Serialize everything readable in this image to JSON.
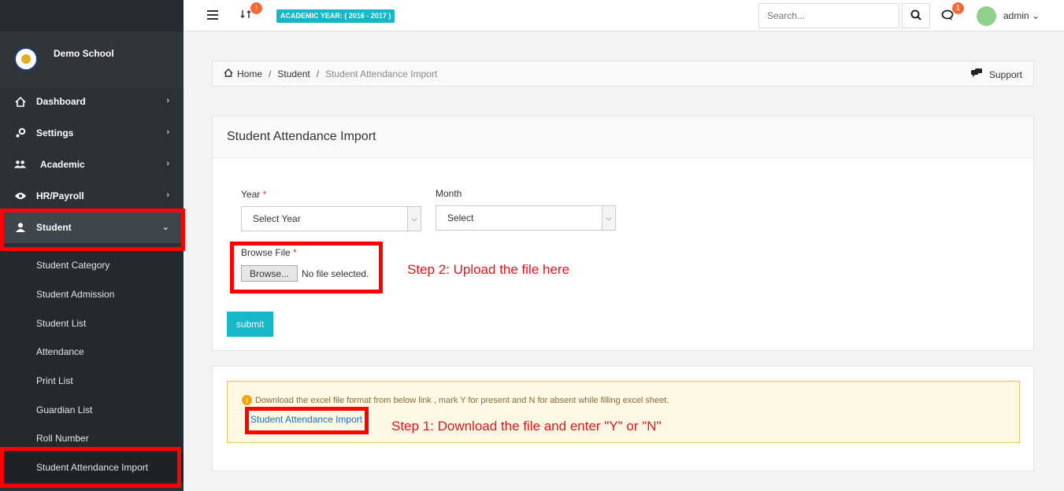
{
  "app": {
    "school_name": "Demo School",
    "academic_year": "ACADEMIC YEAR: ( 2016 - 2017 )",
    "sync_badge": "!",
    "chat_badge": "1",
    "search_placeholder": "Search...",
    "user": "admin"
  },
  "sidebar": {
    "items": [
      {
        "label": "Dashboard",
        "icon": "home-icon"
      },
      {
        "label": "Settings",
        "icon": "gear-icon"
      },
      {
        "label": "Academic",
        "icon": "users-icon"
      },
      {
        "label": "HR/Payroll",
        "icon": "eye-icon"
      },
      {
        "label": "Student",
        "icon": "user-icon"
      }
    ],
    "sub_items": [
      "Student Category",
      "Student Admission",
      "Student List",
      "Attendance",
      "Print List",
      "Guardian List",
      "Roll Number",
      "Student Attendance Import"
    ]
  },
  "breadcrumb": {
    "home": "Home",
    "section": "Student",
    "current": "Student Attendance Import",
    "support": "Support"
  },
  "form": {
    "title": "Student Attendance Import",
    "year_label": "Year",
    "year_value": "Select Year",
    "month_label": "Month",
    "month_value": "Select",
    "file_label": "Browse File",
    "required_mark": "*",
    "browse_button": "Browse...",
    "file_status": "No file selected.",
    "submit": "submit",
    "step2": "Step 2: Upload the file here"
  },
  "info": {
    "text": "Download the excel file format from below link , mark Y for present and N for absent while filling excel sheet.",
    "link": "Student Attendance Import",
    "step1": "Step 1: Download the file and enter \"Y\" or \"N\""
  },
  "colors": {
    "accent": "#17b6c8",
    "annotation": "#e8141e",
    "sidebar": "#2b3135"
  }
}
